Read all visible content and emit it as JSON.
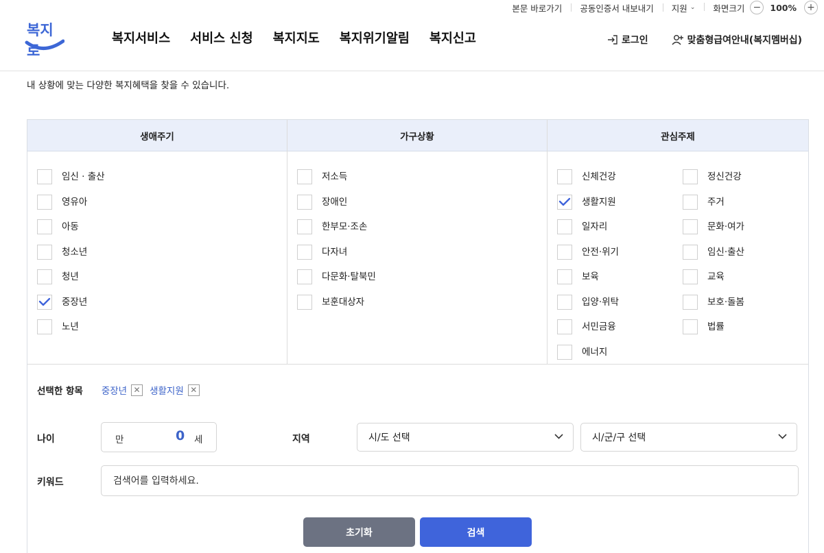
{
  "utility": {
    "skip": "본문 바로가기",
    "cert": "공동인증서 내보내기",
    "support": "지원",
    "screen_size": "화면크기",
    "zoom_minus": "−",
    "zoom_value": "100%",
    "zoom_plus": "+"
  },
  "header": {
    "logo_text": "복지로",
    "nav": [
      "복지서비스",
      "서비스 신청",
      "복지지도",
      "복지위기알림",
      "복지신고"
    ],
    "login": "로그인",
    "membership": "맞춤형급여안내(복지멤버십)"
  },
  "intro": "내 상황에 맞는 다양한 복지혜택을 찾을 수 있습니다.",
  "filters": {
    "life_cycle": {
      "title": "생애주기",
      "items": [
        {
          "label": "임신 · 출산",
          "checked": false
        },
        {
          "label": "영유아",
          "checked": false
        },
        {
          "label": "아동",
          "checked": false
        },
        {
          "label": "청소년",
          "checked": false
        },
        {
          "label": "청년",
          "checked": false
        },
        {
          "label": "중장년",
          "checked": true
        },
        {
          "label": "노년",
          "checked": false
        }
      ]
    },
    "household": {
      "title": "가구상황",
      "items": [
        {
          "label": "저소득",
          "checked": false
        },
        {
          "label": "장애인",
          "checked": false
        },
        {
          "label": "한부모·조손",
          "checked": false
        },
        {
          "label": "다자녀",
          "checked": false
        },
        {
          "label": "다문화·탈북민",
          "checked": false
        },
        {
          "label": "보훈대상자",
          "checked": false
        }
      ]
    },
    "interest": {
      "title": "관심주제",
      "left": [
        {
          "label": "신체건강",
          "checked": false
        },
        {
          "label": "생활지원",
          "checked": true
        },
        {
          "label": "일자리",
          "checked": false
        },
        {
          "label": "안전·위기",
          "checked": false
        },
        {
          "label": "보육",
          "checked": false
        },
        {
          "label": "입양·위탁",
          "checked": false
        },
        {
          "label": "서민금융",
          "checked": false
        },
        {
          "label": "에너지",
          "checked": false
        }
      ],
      "right": [
        {
          "label": "정신건강",
          "checked": false
        },
        {
          "label": "주거",
          "checked": false
        },
        {
          "label": "문화·여가",
          "checked": false
        },
        {
          "label": "임신·출산",
          "checked": false
        },
        {
          "label": "교육",
          "checked": false
        },
        {
          "label": "보호·돌봄",
          "checked": false
        },
        {
          "label": "법률",
          "checked": false
        }
      ]
    }
  },
  "selected": {
    "title": "선택한 항목",
    "tags": [
      "중장년",
      "생활지원"
    ],
    "remove_glyph": "✕"
  },
  "form": {
    "age_label": "나이",
    "age_prefix": "만",
    "age_value": "0",
    "age_suffix": "세",
    "region_label": "지역",
    "sido": "시/도 선택",
    "sigungu": "시/군/구 선택",
    "keyword_label": "키워드",
    "keyword_placeholder": "검색어를 입력하세요.",
    "keyword_value": ""
  },
  "buttons": {
    "reset": "초기화",
    "search": "검색"
  },
  "colors": {
    "accent": "#3f64db",
    "tag_text": "#3c63c9",
    "header_bg": "#eaeffa",
    "reset_bg": "#6c7282"
  }
}
